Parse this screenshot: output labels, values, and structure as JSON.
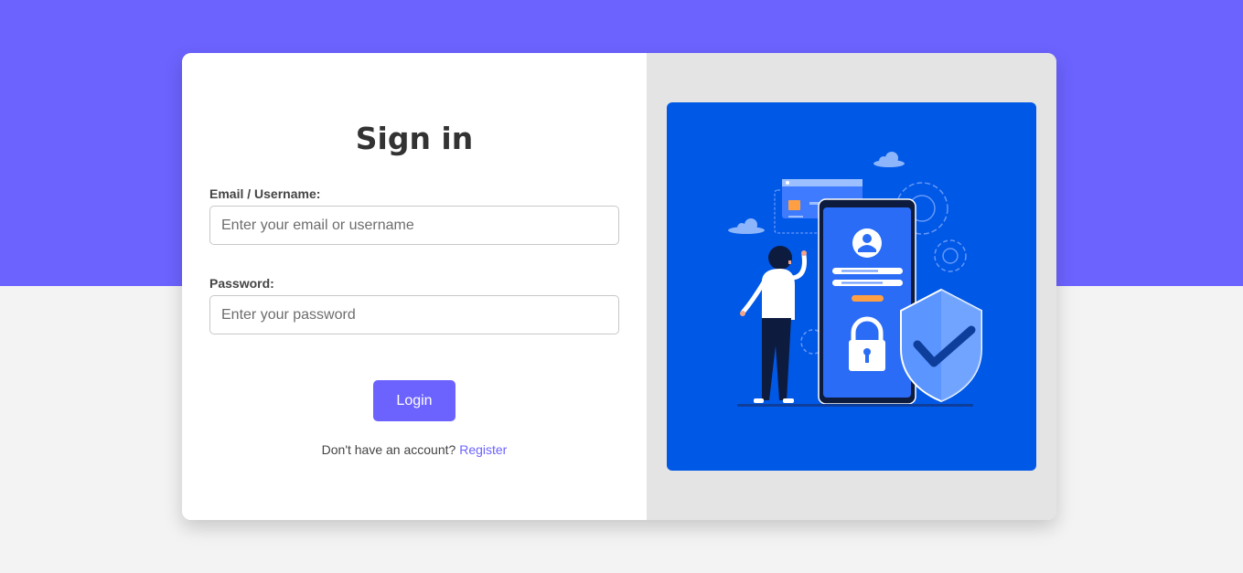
{
  "colors": {
    "accent": "#6c63ff",
    "background": "#f3f3f3",
    "card": "#ffffff",
    "panel": "#e4e4e4",
    "illustration_bg": "#0058e6"
  },
  "form": {
    "title": "Sign in",
    "email": {
      "label": "Email / Username:",
      "placeholder": "Enter your email or username",
      "value": ""
    },
    "password": {
      "label": "Password:",
      "placeholder": "Enter your password",
      "value": ""
    },
    "login_label": "Login",
    "register_prompt": "Don't have an account?",
    "register_link": "Register"
  },
  "illustration": {
    "icon": "secure-login-illustration"
  }
}
